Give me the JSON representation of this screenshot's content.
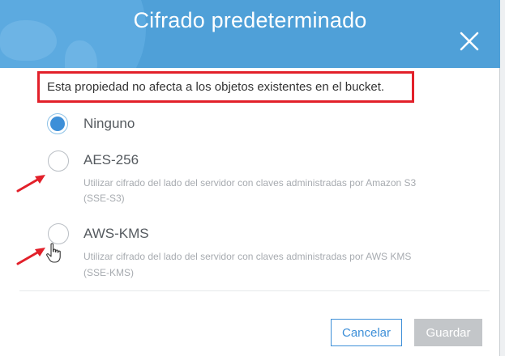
{
  "dialog": {
    "title": "Cifrado predeterminado",
    "notice": "Esta propiedad no afecta a los objetos existentes en el bucket.",
    "options": [
      {
        "label": "Ninguno",
        "selected": true
      },
      {
        "label": "AES-256",
        "selected": false,
        "description_line1": "Utilizar cifrado del lado del servidor con claves administradas por Amazon S3",
        "description_line2": "(SSE-S3)"
      },
      {
        "label": "AWS-KMS",
        "selected": false,
        "description_line1": "Utilizar cifrado del lado del servidor con claves administradas por AWS KMS",
        "description_line2": "(SSE-KMS)"
      }
    ],
    "buttons": {
      "cancel": "Cancelar",
      "save": "Guardar"
    }
  },
  "colors": {
    "header": "#4fa0d8",
    "accent": "#3d8fd8",
    "highlight_box": "#e2202a",
    "annotation_arrow": "#e2202a",
    "disabled_button": "#c3c6c9"
  },
  "icons": {
    "close": "close-icon",
    "cursor": "hand-pointer-icon",
    "arrow": "red-arrow-icon"
  }
}
